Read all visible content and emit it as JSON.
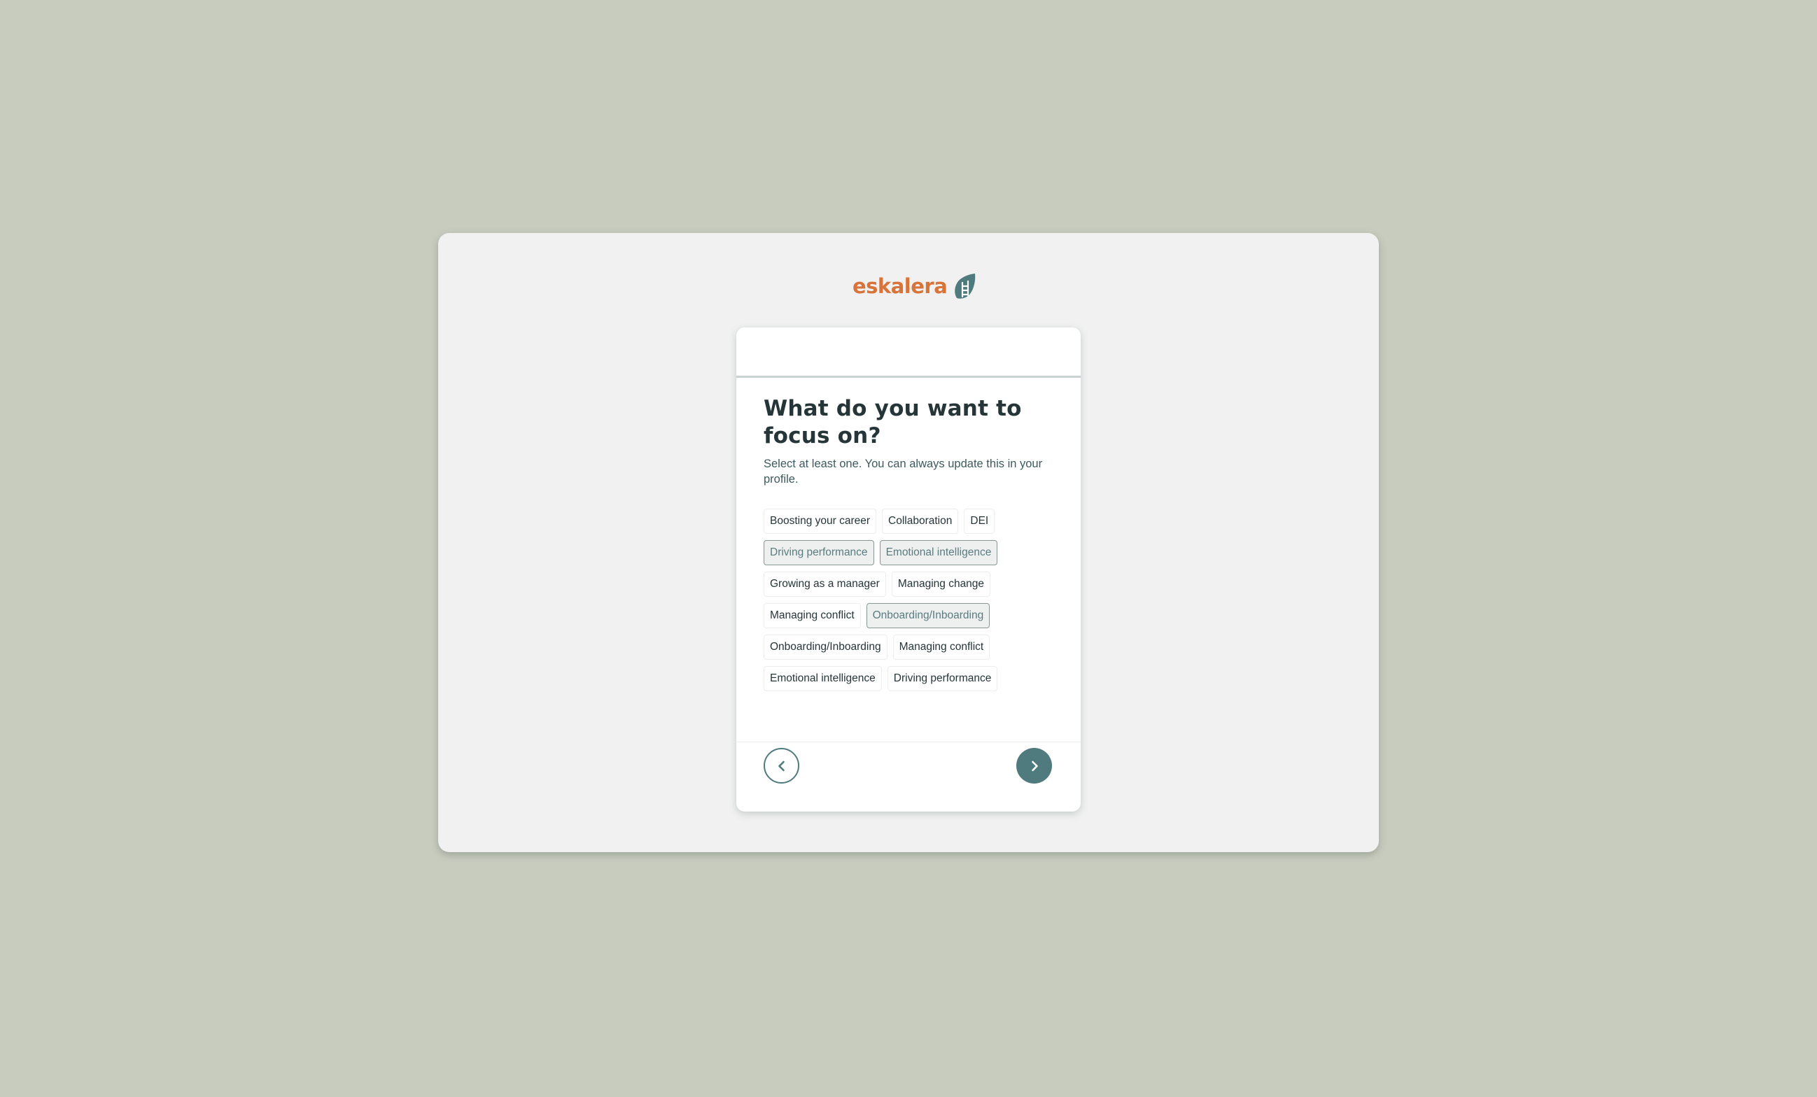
{
  "brand": {
    "name": "eskalera",
    "logo_icon": "leaf-ladder-icon",
    "colors": {
      "logo_text": "#d8743a",
      "accent": "#4f7a7e",
      "page_background": "#c8ccbf",
      "panel_background": "#f0f1f0"
    }
  },
  "step": {
    "title": "What do you want to focus on?",
    "subtitle": "Select at least one. You can always update this in your profile."
  },
  "topics": [
    {
      "label": "Boosting your career",
      "selected": false
    },
    {
      "label": "Collaboration",
      "selected": false
    },
    {
      "label": "DEI",
      "selected": false
    },
    {
      "label": "Driving performance",
      "selected": true
    },
    {
      "label": "Emotional intelligence",
      "selected": true
    },
    {
      "label": "Growing as a manager",
      "selected": false
    },
    {
      "label": "Managing change",
      "selected": false
    },
    {
      "label": "Managing conflict",
      "selected": false
    },
    {
      "label": "Onboarding/Inboarding",
      "selected": true
    },
    {
      "label": "Onboarding/Inboarding",
      "selected": false
    },
    {
      "label": "Managing conflict",
      "selected": false
    },
    {
      "label": "Emotional intelligence",
      "selected": false
    },
    {
      "label": "Driving performance",
      "selected": false
    }
  ],
  "navigation": {
    "back_icon": "chevron-left-icon",
    "next_icon": "chevron-right-icon"
  }
}
